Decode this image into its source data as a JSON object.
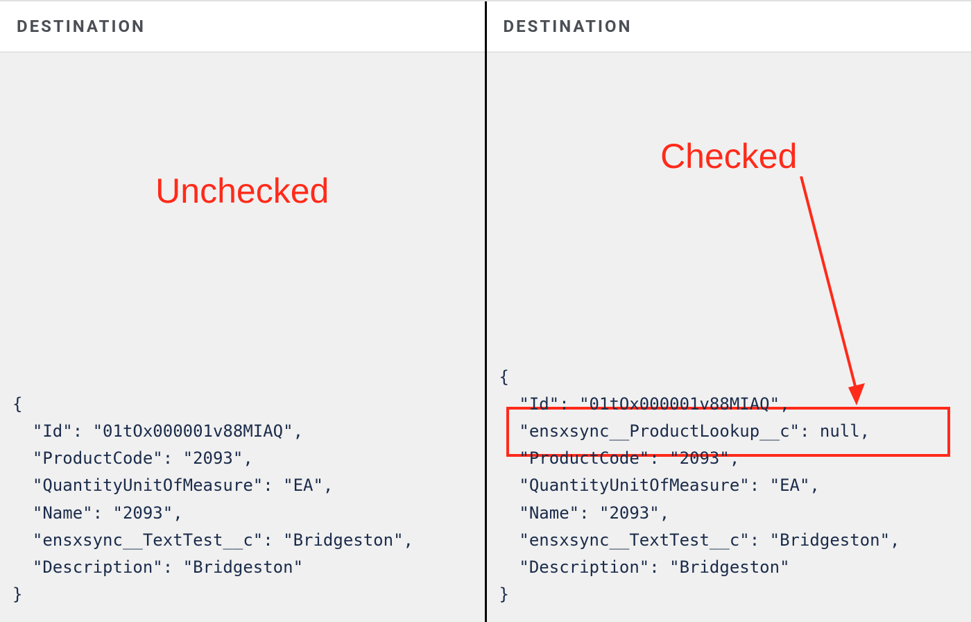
{
  "left": {
    "header": "DESTINATION",
    "annotation": "Unchecked",
    "code": "{\n  \"Id\": \"01tOx000001v88MIAQ\",\n  \"ProductCode\": \"2093\",\n  \"QuantityUnitOfMeasure\": \"EA\",\n  \"Name\": \"2093\",\n  \"ensxsync__TextTest__c\": \"Bridgeston\",\n  \"Description\": \"Bridgeston\"\n}"
  },
  "right": {
    "header": "DESTINATION",
    "annotation": "Checked",
    "code": "{\n  \"Id\": \"01tOx000001v88MIAQ\",\n  \"ensxsync__ProductLookup__c\": null,\n  \"ProductCode\": \"2093\",\n  \"QuantityUnitOfMeasure\": \"EA\",\n  \"Name\": \"2093\",\n  \"ensxsync__TextTest__c\": \"Bridgeston\",\n  \"Description\": \"Bridgeston\"\n}"
  }
}
